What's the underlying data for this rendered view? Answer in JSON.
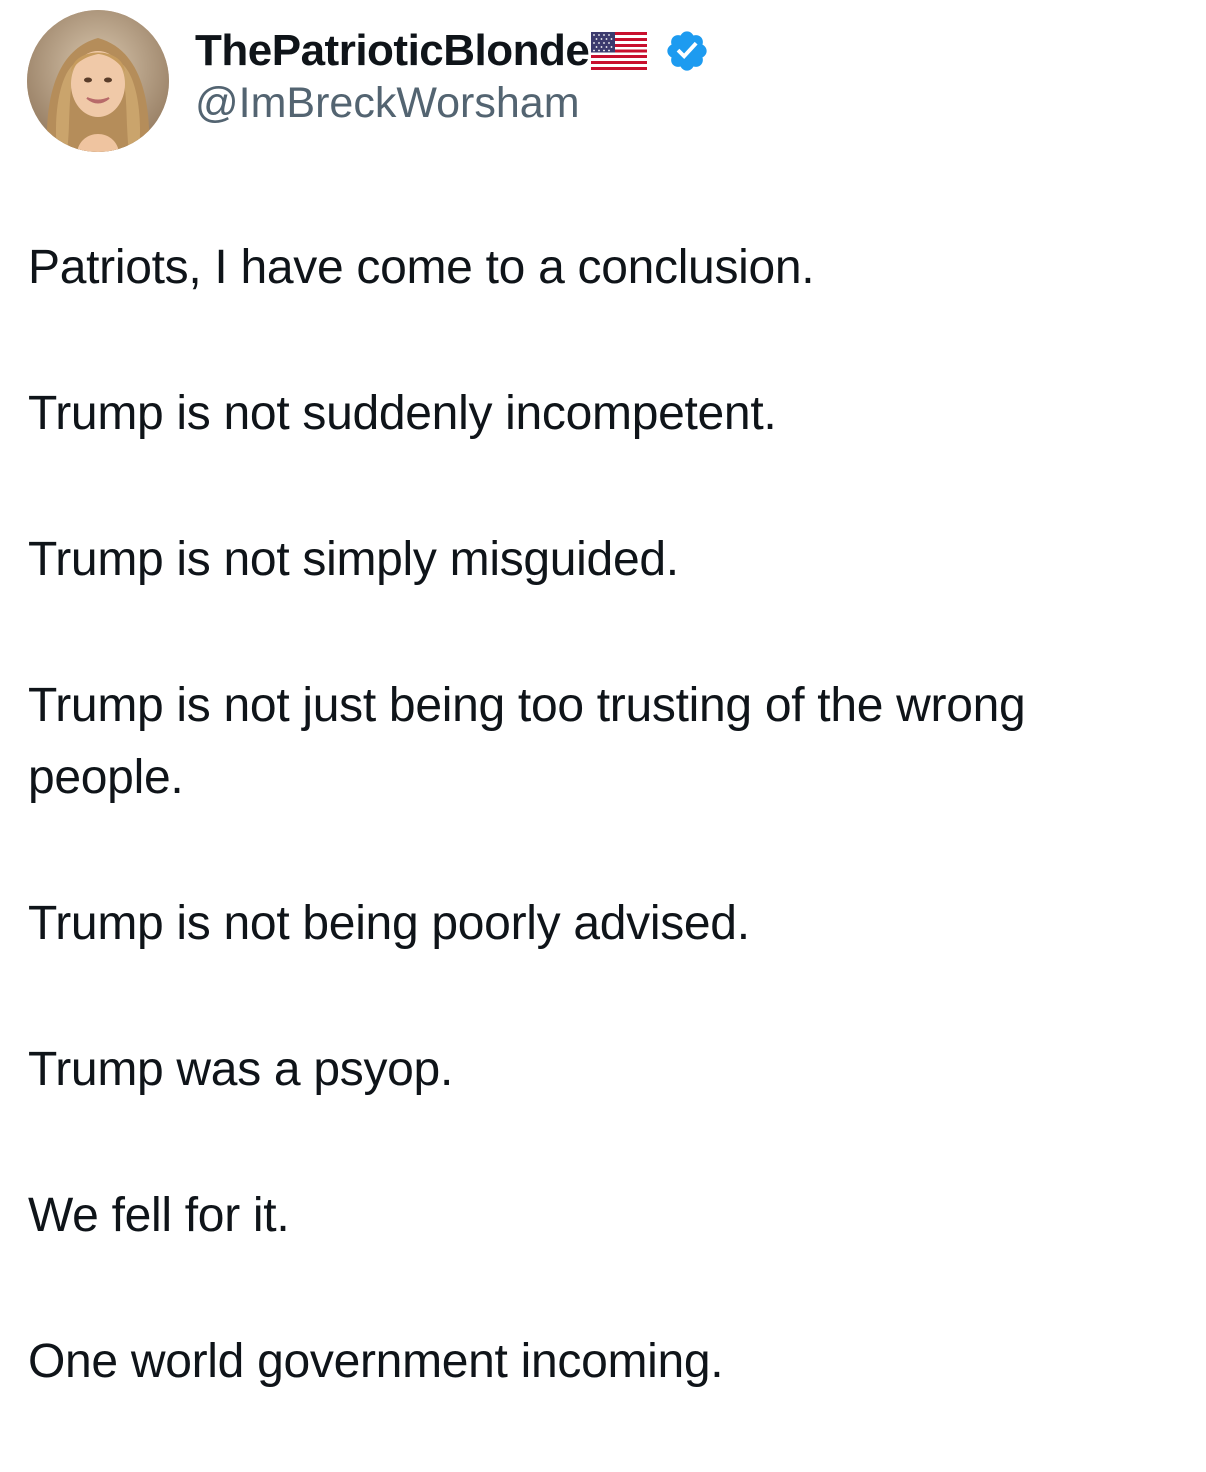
{
  "author": {
    "display_name": "ThePatrioticBlonde",
    "handle": "@ImBreckWorsham",
    "flag_icon": "us-flag-icon",
    "verified_icon": "verified-badge-icon",
    "verified_color": "#1d9bf0"
  },
  "tweet": {
    "paragraphs": [
      "Patriots, I have come to a conclusion.",
      "Trump is not suddenly incompetent.",
      "Trump is not simply misguided.",
      "Trump is not just being too trusting of the wrong people.",
      "Trump is not being poorly advised.",
      "Trump was a psyop.",
      "We fell for it.",
      "One world government incoming."
    ]
  },
  "colors": {
    "text": "#0f1419",
    "handle": "#536471",
    "background": "#ffffff"
  }
}
